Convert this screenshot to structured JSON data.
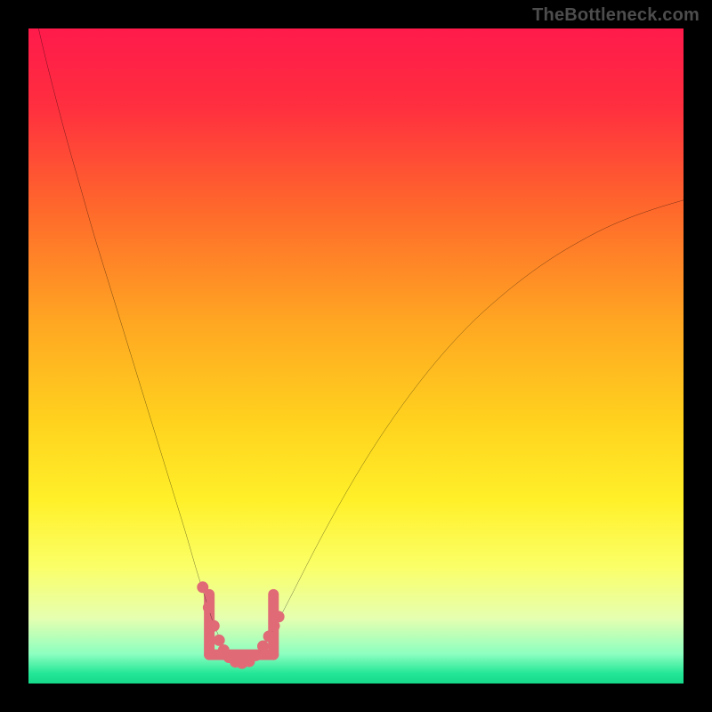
{
  "watermark": {
    "text": "TheBottleneck.com"
  },
  "chart_data": {
    "type": "line",
    "title": "",
    "xlabel": "",
    "ylabel": "",
    "xlim": [
      0,
      100
    ],
    "ylim": [
      0,
      100
    ],
    "gradient_stops": [
      {
        "offset": 0.0,
        "color": "#ff1a4b"
      },
      {
        "offset": 0.12,
        "color": "#ff2f3f"
      },
      {
        "offset": 0.28,
        "color": "#ff6a2b"
      },
      {
        "offset": 0.45,
        "color": "#ffa722"
      },
      {
        "offset": 0.6,
        "color": "#ffd21e"
      },
      {
        "offset": 0.72,
        "color": "#fff029"
      },
      {
        "offset": 0.82,
        "color": "#fbff66"
      },
      {
        "offset": 0.9,
        "color": "#e6ffb0"
      },
      {
        "offset": 0.955,
        "color": "#8cffc0"
      },
      {
        "offset": 0.985,
        "color": "#23e696"
      },
      {
        "offset": 1.0,
        "color": "#16d98a"
      }
    ],
    "series": [
      {
        "name": "bottleneck-curve",
        "color": "#000000",
        "width": 2,
        "x": [
          0.0,
          2.0,
          4.0,
          6.0,
          8.0,
          10.0,
          12.0,
          14.0,
          16.0,
          18.0,
          20.0,
          22.0,
          24.0,
          25.6,
          27.0,
          28.2,
          29.3,
          30.0,
          31.0,
          32.0,
          33.0,
          33.8,
          35.0,
          37.0,
          40.0,
          44.0,
          48.0,
          52.0,
          56.0,
          60.0,
          64.0,
          68.0,
          72.0,
          76.0,
          80.0,
          84.0,
          88.0,
          92.0,
          96.0,
          100.0
        ],
        "y": [
          107.0,
          98.0,
          90.0,
          82.5,
          75.5,
          68.5,
          62.0,
          55.5,
          49.0,
          42.5,
          36.0,
          29.5,
          23.0,
          17.5,
          13.0,
          9.3,
          6.7,
          5.0,
          3.8,
          3.1,
          3.0,
          3.3,
          4.5,
          7.5,
          13.2,
          21.0,
          28.3,
          35.0,
          41.0,
          46.4,
          51.2,
          55.4,
          59.0,
          62.2,
          65.0,
          67.4,
          69.5,
          71.2,
          72.6,
          73.8
        ]
      }
    ],
    "highlight": {
      "color": "#e06b77",
      "radius": 6.5,
      "indices_on_curve": [
        23,
        24,
        25,
        26,
        27,
        28,
        29,
        30,
        31,
        32,
        33,
        34,
        35,
        36
      ]
    },
    "highlight_points_xy": [
      [
        26.6,
        14.7
      ],
      [
        27.5,
        11.6
      ],
      [
        28.3,
        8.8
      ],
      [
        29.1,
        6.6
      ],
      [
        29.8,
        5.1
      ],
      [
        30.6,
        4.0
      ],
      [
        31.6,
        3.3
      ],
      [
        32.6,
        3.1
      ],
      [
        33.7,
        3.4
      ],
      [
        34.7,
        4.3
      ],
      [
        35.8,
        5.7
      ],
      [
        36.7,
        7.2
      ],
      [
        37.5,
        8.8
      ],
      [
        38.2,
        10.2
      ]
    ],
    "highlight_bracket": {
      "color": "#e06b77",
      "width": 12,
      "left_x": 27.6,
      "right_x": 37.4,
      "bottom_y": 4.4,
      "top_y": 13.6
    }
  }
}
